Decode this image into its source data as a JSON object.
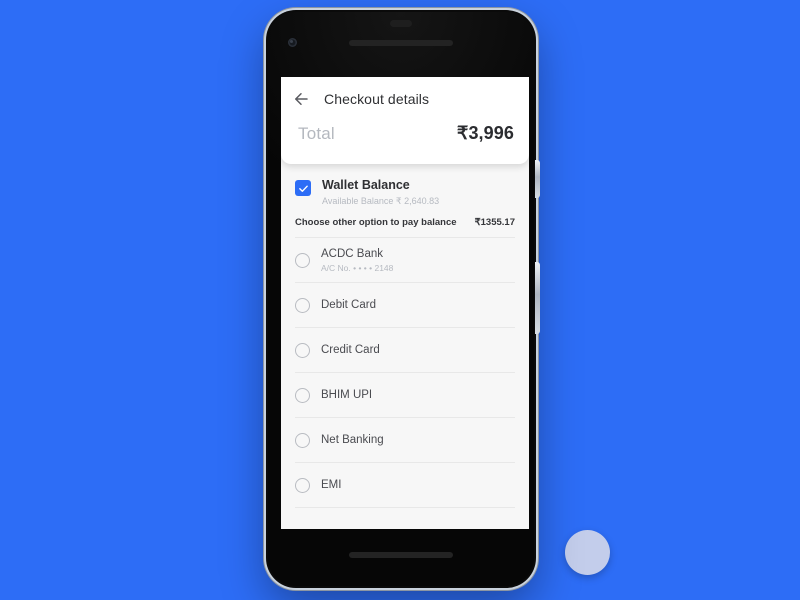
{
  "background_color": "#2d6df6",
  "accent_color": "#2d6df6",
  "app": {
    "appbar": {
      "back_icon": "arrow-left-icon",
      "title": "Checkout details"
    },
    "total": {
      "label": "Total",
      "amount": "₹3,996"
    },
    "wallet": {
      "checkbox_checked": true,
      "title": "Wallet Balance",
      "subtitle": "Available Balance ₹ 2,640.83",
      "balance_label": "Choose other option to pay balance",
      "balance_amount": "₹1355.17"
    },
    "payment_options": [
      {
        "label": "ACDC Bank",
        "sub": "A/C No. • • • • 2148",
        "selected": false
      },
      {
        "label": "Debit Card",
        "sub": "",
        "selected": false
      },
      {
        "label": "Credit Card",
        "sub": "",
        "selected": false
      },
      {
        "label": "BHIM UPI",
        "sub": "",
        "selected": false
      },
      {
        "label": "Net Banking",
        "sub": "",
        "selected": false
      },
      {
        "label": "EMI",
        "sub": "",
        "selected": false
      }
    ]
  }
}
